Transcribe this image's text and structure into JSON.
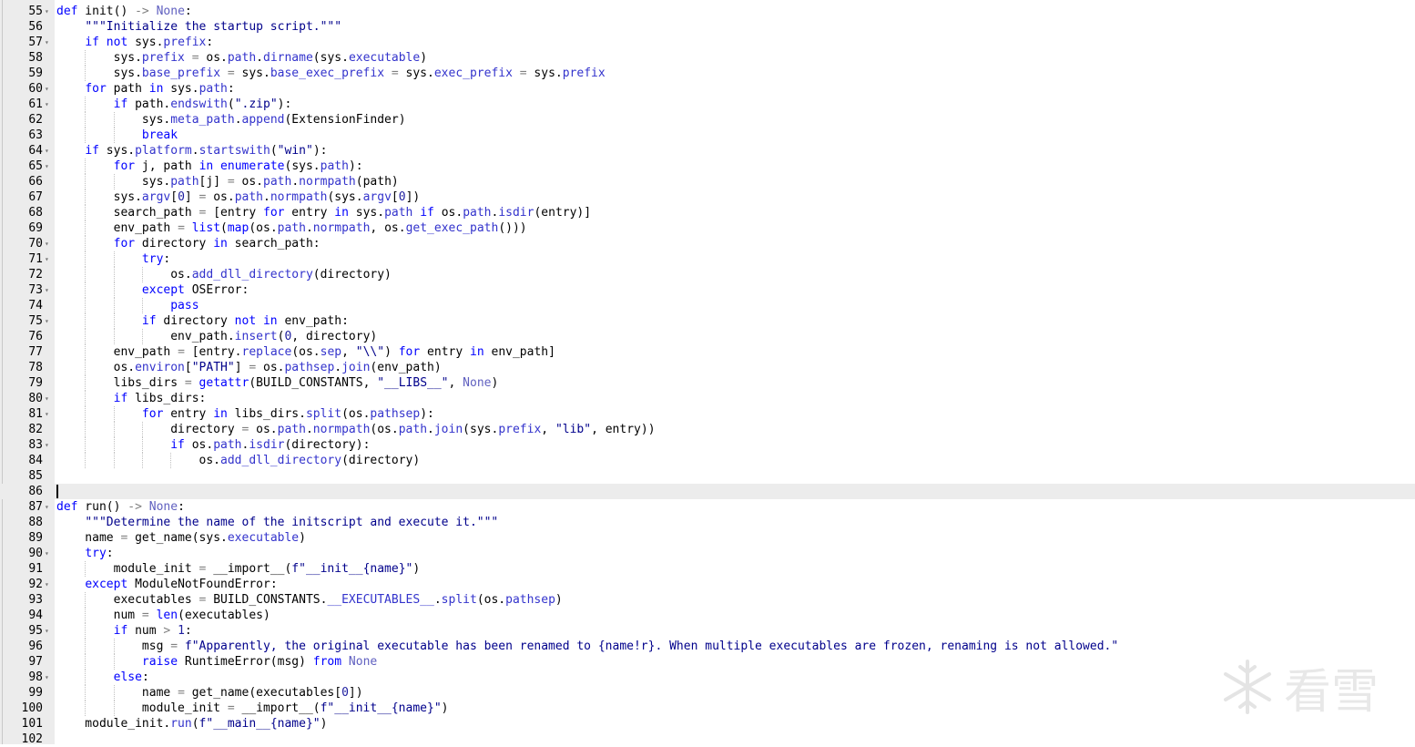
{
  "editor": {
    "language": "python",
    "current_line": 86,
    "colors": {
      "keyword": "#0000ff",
      "string": "#00008b",
      "gutter_bg": "#ececec",
      "current_line_bg": "#ececec"
    },
    "lines": [
      {
        "n": "55",
        "fold": true,
        "text": "def init() -> None:"
      },
      {
        "n": "56",
        "fold": false,
        "text": "    \"\"\"Initialize the startup script.\"\"\""
      },
      {
        "n": "57",
        "fold": true,
        "text": "    if not sys.prefix:"
      },
      {
        "n": "58",
        "fold": false,
        "text": "        sys.prefix = os.path.dirname(sys.executable)"
      },
      {
        "n": "59",
        "fold": false,
        "text": "        sys.base_prefix = sys.base_exec_prefix = sys.exec_prefix = sys.prefix"
      },
      {
        "n": "60",
        "fold": true,
        "text": "    for path in sys.path:"
      },
      {
        "n": "61",
        "fold": true,
        "text": "        if path.endswith(\".zip\"):"
      },
      {
        "n": "62",
        "fold": false,
        "text": "            sys.meta_path.append(ExtensionFinder)"
      },
      {
        "n": "63",
        "fold": false,
        "text": "            break"
      },
      {
        "n": "64",
        "fold": true,
        "text": "    if sys.platform.startswith(\"win\"):"
      },
      {
        "n": "65",
        "fold": true,
        "text": "        for j, path in enumerate(sys.path):"
      },
      {
        "n": "66",
        "fold": false,
        "text": "            sys.path[j] = os.path.normpath(path)"
      },
      {
        "n": "67",
        "fold": false,
        "text": "        sys.argv[0] = os.path.normpath(sys.argv[0])"
      },
      {
        "n": "68",
        "fold": false,
        "text": "        search_path = [entry for entry in sys.path if os.path.isdir(entry)]"
      },
      {
        "n": "69",
        "fold": false,
        "text": "        env_path = list(map(os.path.normpath, os.get_exec_path()))"
      },
      {
        "n": "70",
        "fold": true,
        "text": "        for directory in search_path:"
      },
      {
        "n": "71",
        "fold": true,
        "text": "            try:"
      },
      {
        "n": "72",
        "fold": false,
        "text": "                os.add_dll_directory(directory)"
      },
      {
        "n": "73",
        "fold": true,
        "text": "            except OSError:"
      },
      {
        "n": "74",
        "fold": false,
        "text": "                pass"
      },
      {
        "n": "75",
        "fold": true,
        "text": "            if directory not in env_path:"
      },
      {
        "n": "76",
        "fold": false,
        "text": "                env_path.insert(0, directory)"
      },
      {
        "n": "77",
        "fold": false,
        "text": "        env_path = [entry.replace(os.sep, \"\\\\\") for entry in env_path]"
      },
      {
        "n": "78",
        "fold": false,
        "text": "        os.environ[\"PATH\"] = os.pathsep.join(env_path)"
      },
      {
        "n": "79",
        "fold": false,
        "text": "        libs_dirs = getattr(BUILD_CONSTANTS, \"__LIBS__\", None)"
      },
      {
        "n": "80",
        "fold": true,
        "text": "        if libs_dirs:"
      },
      {
        "n": "81",
        "fold": true,
        "text": "            for entry in libs_dirs.split(os.pathsep):"
      },
      {
        "n": "82",
        "fold": false,
        "text": "                directory = os.path.normpath(os.path.join(sys.prefix, \"lib\", entry))"
      },
      {
        "n": "83",
        "fold": true,
        "text": "                if os.path.isdir(directory):"
      },
      {
        "n": "84",
        "fold": false,
        "text": "                    os.add_dll_directory(directory)"
      },
      {
        "n": "85",
        "fold": false,
        "text": ""
      },
      {
        "n": "86",
        "fold": false,
        "text": ""
      },
      {
        "n": "87",
        "fold": true,
        "text": "def run() -> None:"
      },
      {
        "n": "88",
        "fold": false,
        "text": "    \"\"\"Determine the name of the initscript and execute it.\"\"\""
      },
      {
        "n": "89",
        "fold": false,
        "text": "    name = get_name(sys.executable)"
      },
      {
        "n": "90",
        "fold": true,
        "text": "    try:"
      },
      {
        "n": "91",
        "fold": false,
        "text": "        module_init = __import__(f\"__init__{name}\")"
      },
      {
        "n": "92",
        "fold": true,
        "text": "    except ModuleNotFoundError:"
      },
      {
        "n": "93",
        "fold": false,
        "text": "        executables = BUILD_CONSTANTS.__EXECUTABLES__.split(os.pathsep)"
      },
      {
        "n": "94",
        "fold": false,
        "text": "        num = len(executables)"
      },
      {
        "n": "95",
        "fold": true,
        "text": "        if num > 1:"
      },
      {
        "n": "96",
        "fold": false,
        "text": "            msg = f\"Apparently, the original executable has been renamed to {name!r}. When multiple executables are frozen, renaming is not allowed.\""
      },
      {
        "n": "97",
        "fold": false,
        "text": "            raise RuntimeError(msg) from None"
      },
      {
        "n": "98",
        "fold": true,
        "text": "        else:"
      },
      {
        "n": "99",
        "fold": false,
        "text": "            name = get_name(executables[0])"
      },
      {
        "n": "100",
        "fold": false,
        "text": "            module_init = __import__(f\"__init__{name}\")"
      },
      {
        "n": "101",
        "fold": false,
        "text": "    module_init.run(f\"__main__{name}\")"
      },
      {
        "n": "102",
        "fold": false,
        "text": ""
      }
    ]
  },
  "watermark": {
    "text": "看雪",
    "icon": "snowflake-icon"
  }
}
